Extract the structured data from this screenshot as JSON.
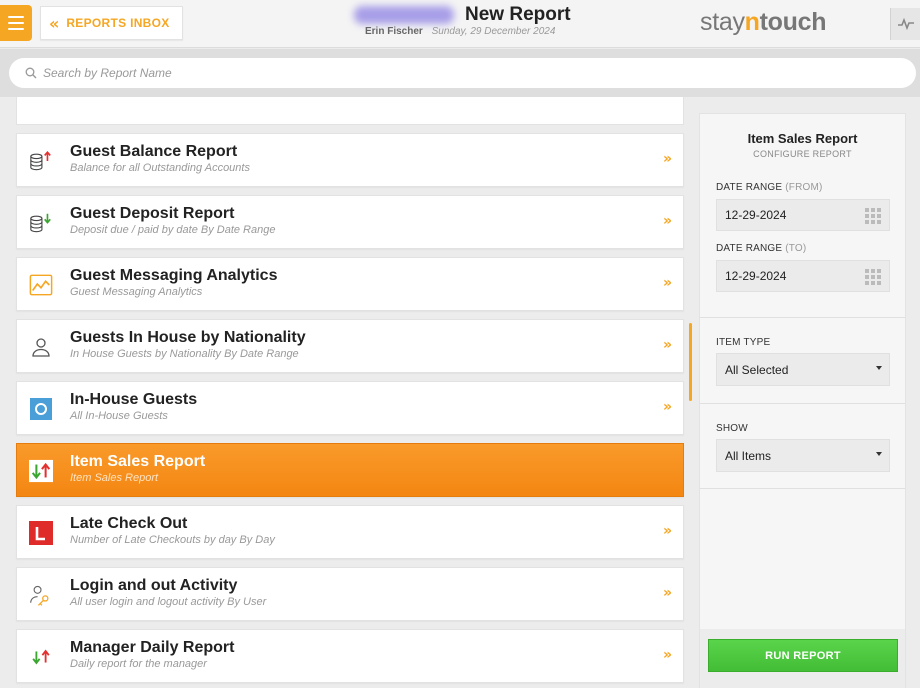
{
  "header": {
    "back_label": "REPORTS INBOX",
    "title": "New Report",
    "user": "Erin Fischer",
    "date": "Sunday, 29 December 2024",
    "logo": {
      "pre": "stay",
      "mid": "n",
      "end": "touch"
    }
  },
  "search": {
    "placeholder": "Search by Report Name",
    "value": ""
  },
  "reports": [
    {
      "title": "Guest Balance Report",
      "desc": "Balance for all Outstanding Accounts",
      "icon": "coins-up-icon"
    },
    {
      "title": "Guest Deposit Report",
      "desc": "Deposit due / paid by date By Date Range",
      "icon": "coins-down-icon"
    },
    {
      "title": "Guest Messaging Analytics",
      "desc": "Guest Messaging Analytics",
      "icon": "analytics-chart-icon"
    },
    {
      "title": "Guests In House by Nationality",
      "desc": "In House Guests by Nationality By Date Range",
      "icon": "person-icon"
    },
    {
      "title": "In-House Guests",
      "desc": "All In-House Guests",
      "icon": "in-house-icon"
    },
    {
      "title": "Item Sales Report",
      "desc": "Item Sales Report",
      "icon": "arrows-up-down-icon",
      "active": true
    },
    {
      "title": "Late Check Out",
      "desc": "Number of Late Checkouts by day By Day",
      "icon": "late-checkout-icon"
    },
    {
      "title": "Login and out Activity",
      "desc": "All user login and logout activity By User",
      "icon": "user-key-icon"
    },
    {
      "title": "Manager Daily Report",
      "desc": "Daily report for the manager",
      "icon": "arrows-up-down-icon"
    }
  ],
  "config": {
    "title": "Item Sales Report",
    "subtitle": "CONFIGURE REPORT",
    "date_from_label": "DATE RANGE",
    "date_from_suffix": "(FROM)",
    "date_from": "12-29-2024",
    "date_to_label": "DATE RANGE",
    "date_to_suffix": "(TO)",
    "date_to": "12-29-2024",
    "item_type_label": "ITEM TYPE",
    "item_type_value": "All Selected",
    "show_label": "SHOW",
    "show_value": "All Items",
    "run_label": "RUN REPORT"
  },
  "colors": {
    "accent": "#f5a623",
    "active_row": "#f48612",
    "run_button": "#4cc63e"
  }
}
